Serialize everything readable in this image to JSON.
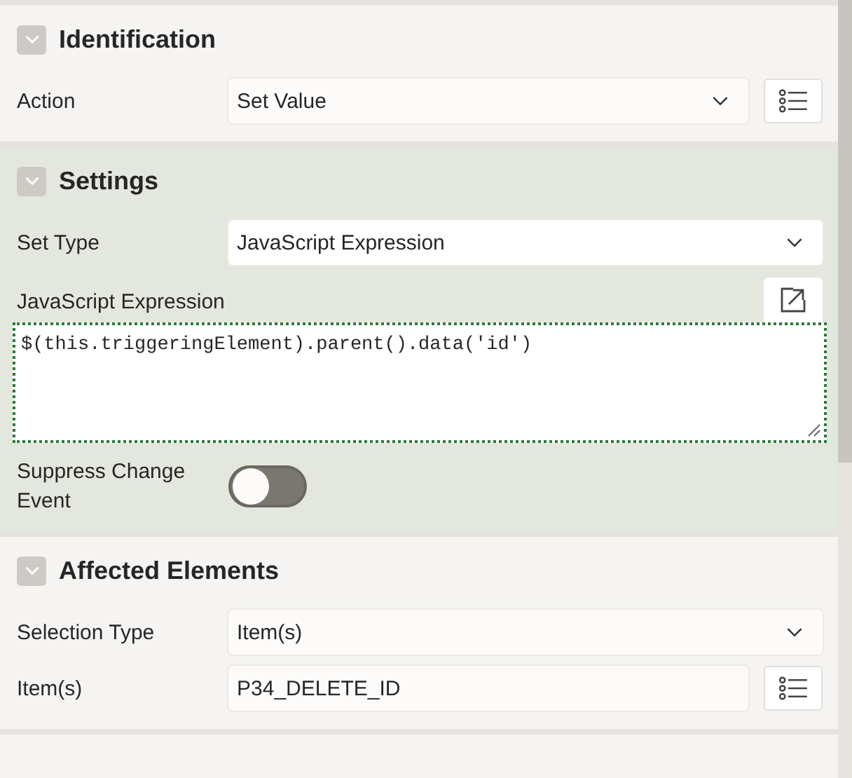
{
  "sections": [
    {
      "title": "Identification",
      "expanded": true,
      "selected": false,
      "rows": [
        {
          "kind": "select",
          "label": "Action",
          "value": "Set Value",
          "picker": true
        }
      ]
    },
    {
      "title": "Settings",
      "expanded": true,
      "selected": true,
      "rows": [
        {
          "kind": "select",
          "label": "Set Type",
          "value": "JavaScript Expression",
          "picker": false
        },
        {
          "kind": "code",
          "label": "JavaScript Expression",
          "value": "$(this.triggeringElement).parent().data('id')",
          "focused": true
        },
        {
          "kind": "toggle",
          "label": "Suppress Change Event",
          "on": false
        }
      ]
    },
    {
      "title": "Affected Elements",
      "expanded": true,
      "selected": false,
      "rows": [
        {
          "kind": "select",
          "label": "Selection Type",
          "value": "Item(s)",
          "picker": false
        },
        {
          "kind": "text",
          "label": "Item(s)",
          "value": "P34_DELETE_ID",
          "picker": true
        }
      ]
    }
  ]
}
